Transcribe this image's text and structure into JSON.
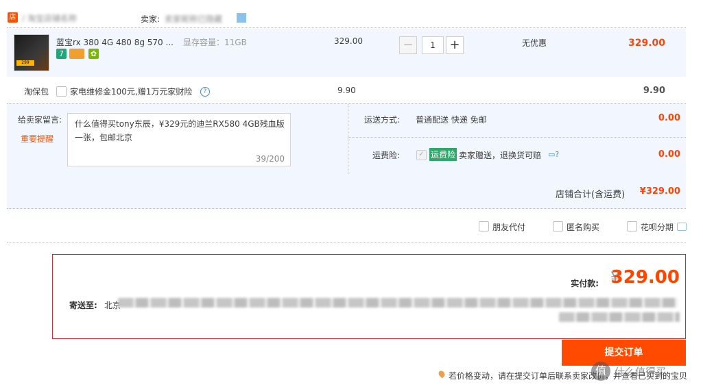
{
  "shop": {
    "icon": "store-icon",
    "name_blurred": "/ 淘宝店铺名称",
    "seller_label": "卖家:",
    "seller_name_blurred": "卖家昵称已隐藏"
  },
  "item": {
    "title": "蓝宝rx 380 4G 480 8g 570 ...",
    "sku_label": "显存容量：11GB",
    "thumb_caption": "299",
    "badges": [
      "7",
      "card",
      "hb"
    ],
    "unit_price": "329.00",
    "quantity": "1",
    "qty_minus": "−",
    "qty_plus": "+",
    "promotion": "无优惠",
    "line_total": "329.00"
  },
  "taobaobao": {
    "label": "淘保包",
    "option_text": "家电维修金100元,赠1万元家财险",
    "help": "?",
    "price": "9.90",
    "total": "9.90"
  },
  "message": {
    "label": "给卖家留言:",
    "warning": "重要提醒",
    "text": "什么值得买tony东辰，¥329元的迪兰RX580 4GB残血版一张，包邮北京",
    "count": "39/200"
  },
  "shipping": {
    "label": "运送方式:",
    "method": "普通配送 快递 免邮",
    "price": "0.00"
  },
  "insurance": {
    "label": "运费险:",
    "check": "✓",
    "tag": "运费险",
    "text": "卖家赠送，退换货可赔",
    "price": "0.00"
  },
  "store_total": {
    "label": "店铺合计(含运费)",
    "value": "¥329.00"
  },
  "options": {
    "friend_pay": "朋友代付",
    "anonymous": "匿名购买",
    "huabei": "花呗分期"
  },
  "summary": {
    "pay_label": "实付款:",
    "yen": "¥",
    "amount": "329.00",
    "addr_label": "寄送至:",
    "addr_city": "北京"
  },
  "submit": {
    "label": "提交订单"
  },
  "note": {
    "text": "若价格变动，请在提交订单后联系卖家改价，并查看已买到的宝贝"
  },
  "watermark": {
    "icon": "值",
    "text": "什么值得买"
  },
  "colors": {
    "accent": "#ff4400",
    "submit": "#ff4a00",
    "highlight_bg": "#f2f7ff",
    "summary_border": "#d52b2b",
    "insurance_tag": "#2ea86a"
  }
}
